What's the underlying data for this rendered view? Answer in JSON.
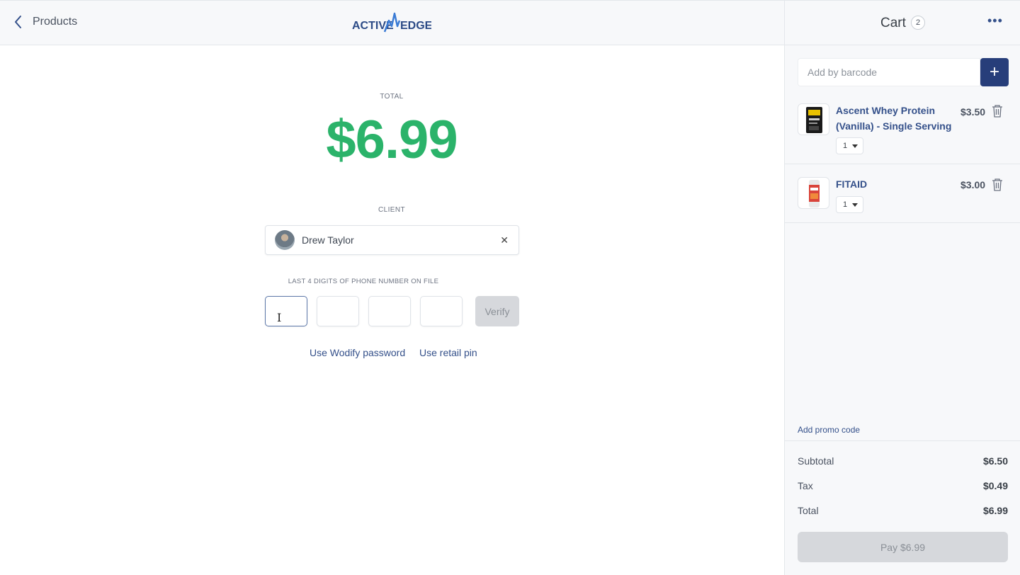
{
  "header": {
    "back_label": "Products",
    "logo_text_left": "ACTIVE",
    "logo_text_right": "EDGE"
  },
  "checkout": {
    "total_label": "TOTAL",
    "total_amount": "$6.99",
    "client_label": "CLIENT",
    "client_name": "Drew Taylor",
    "clear_symbol": "✕",
    "digits_label": "LAST 4 DIGITS OF PHONE NUMBER ON FILE",
    "digits": [
      "",
      "",
      "",
      ""
    ],
    "verify_label": "Verify",
    "alt_password_label": "Use Wodify password",
    "alt_pin_label": "Use retail pin"
  },
  "cart": {
    "title": "Cart",
    "count": "2",
    "menu_symbol": "•••",
    "barcode_placeholder": "Add by barcode",
    "add_symbol": "+",
    "items": [
      {
        "name": "Ascent Whey Protein (Vanilla) - Single Serving",
        "price": "$3.50",
        "qty": "1",
        "icon": "protein-packet-image"
      },
      {
        "name": "FITAID",
        "price": "$3.00",
        "qty": "1",
        "icon": "fitaid-can-image"
      }
    ],
    "promo_label": "Add promo code",
    "subtotal_label": "Subtotal",
    "subtotal_value": "$6.50",
    "tax_label": "Tax",
    "tax_value": "$0.49",
    "total_label": "Total",
    "total_value": "$6.99",
    "pay_label": "Pay $6.99"
  },
  "colors": {
    "accent_blue": "#273e7a",
    "link_blue": "#34508a",
    "total_green": "#2bb36a",
    "disabled_gray": "#d6d8dc"
  }
}
